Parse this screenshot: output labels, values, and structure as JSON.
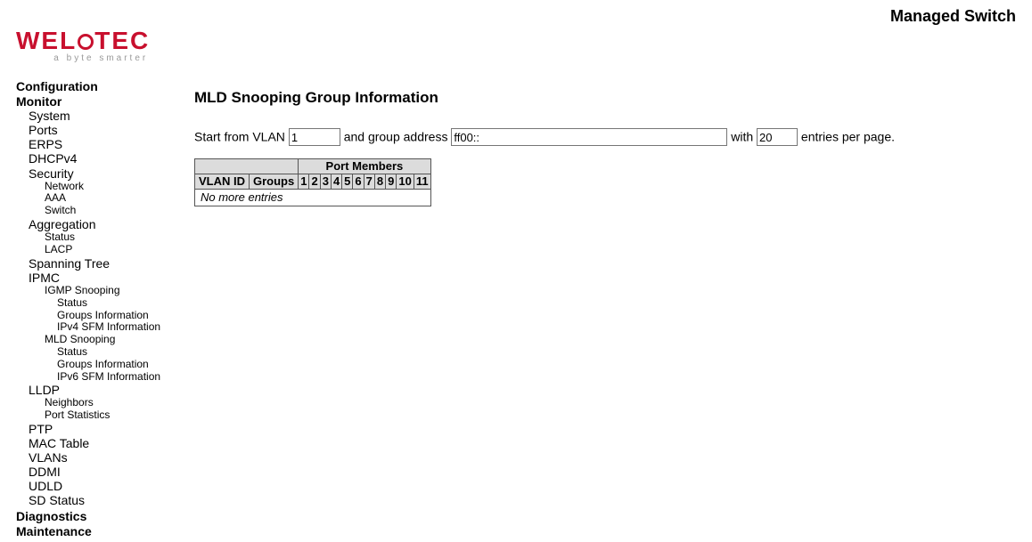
{
  "header": {
    "title": "Managed Switch"
  },
  "logo": {
    "sub": "a byte smarter"
  },
  "nav": {
    "configuration": "Configuration",
    "monitor": "Monitor",
    "system": "System",
    "ports": "Ports",
    "erps": "ERPS",
    "dhcpv4": "DHCPv4",
    "security": "Security",
    "sec_network": "Network",
    "sec_aaa": "AAA",
    "sec_switch": "Switch",
    "aggregation": "Aggregation",
    "agg_status": "Status",
    "agg_lacp": "LACP",
    "spanning_tree": "Spanning Tree",
    "ipmc": "IPMC",
    "igmp_snooping": "IGMP Snooping",
    "igmp_status": "Status",
    "igmp_groups": "Groups Information",
    "igmp_sfm": "IPv4 SFM Information",
    "mld_snooping": "MLD Snooping",
    "mld_status": "Status",
    "mld_groups": "Groups Information",
    "mld_sfm": "IPv6 SFM Information",
    "lldp": "LLDP",
    "lldp_neighbors": "Neighbors",
    "lldp_portstats": "Port Statistics",
    "ptp": "PTP",
    "mac_table": "MAC Table",
    "vlans": "VLANs",
    "ddmi": "DDMI",
    "udld": "UDLD",
    "sd_status": "SD Status",
    "diagnostics": "Diagnostics",
    "maintenance": "Maintenance"
  },
  "page": {
    "title": "MLD Snooping Group Information",
    "label_start_vlan": "Start from VLAN ",
    "label_group_addr": " and group address ",
    "label_with": " with ",
    "label_entries": " entries per page.",
    "vlan_value": "1",
    "group_value": "ff00::",
    "entries_value": "20"
  },
  "table": {
    "port_members": "Port Members",
    "vlan_id": "VLAN ID",
    "groups": "Groups",
    "ports": [
      "1",
      "2",
      "3",
      "4",
      "5",
      "6",
      "7",
      "8",
      "9",
      "10",
      "11"
    ],
    "no_more": "No more entries"
  }
}
